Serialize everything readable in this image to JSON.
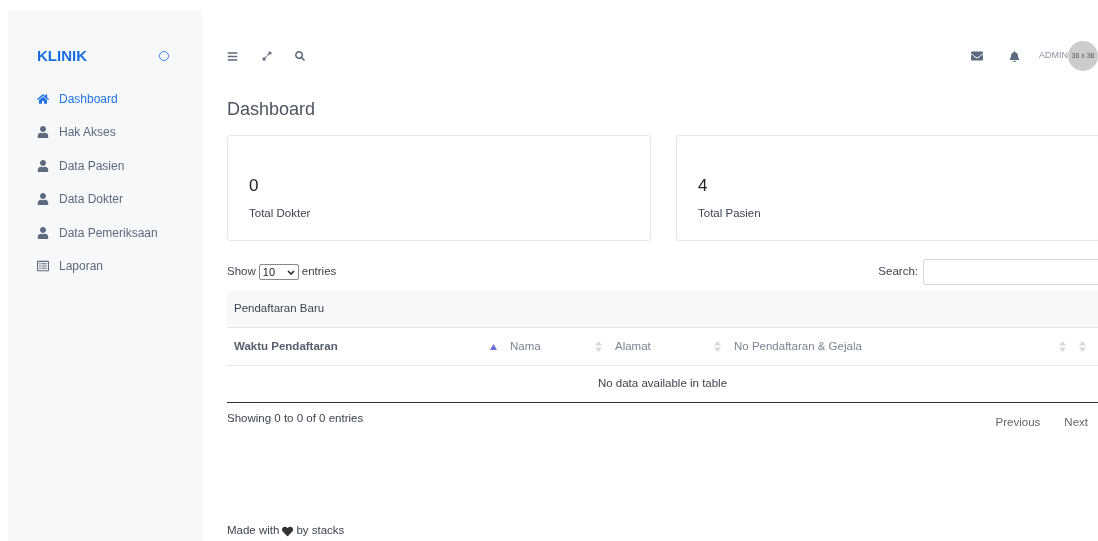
{
  "sidebar": {
    "brand": "KLINIK",
    "items": [
      {
        "label": "Dashboard",
        "kind": "home",
        "selected": true
      },
      {
        "label": "Hak Akses",
        "kind": "user",
        "selected": false
      },
      {
        "label": "Data Pasien",
        "kind": "user",
        "selected": false
      },
      {
        "label": "Data Dokter",
        "kind": "user",
        "selected": false
      },
      {
        "label": "Data Pemeriksaan",
        "kind": "user",
        "selected": false
      },
      {
        "label": "Laporan",
        "kind": "report",
        "selected": false
      }
    ]
  },
  "topbar": {
    "user": "ADMIN",
    "avatar": "36 x 36"
  },
  "page_title": "Dashboard",
  "stats": [
    {
      "value": "0",
      "label": "Total Dokter"
    },
    {
      "value": "4",
      "label": "Total Pasien"
    }
  ],
  "table": {
    "length_prefix": "Show",
    "length_value": "10",
    "length_suffix": "entries",
    "search_label": "Search:",
    "caption": "Pendaftaran Baru",
    "columns": [
      {
        "label": "Waktu Pendaftaran",
        "sorted": true
      },
      {
        "label": "Nama",
        "sorted": false
      },
      {
        "label": "Alamat",
        "sorted": false
      },
      {
        "label": "No Pendaftaran & Gejala",
        "sorted": false
      },
      {
        "sorted": false
      }
    ],
    "empty": "No data available in table",
    "info": "Showing 0 to 0 of 0 entries",
    "pager": [
      "Previous",
      "Next"
    ]
  },
  "footer": {
    "before": "Made with",
    "after": "by stacks"
  }
}
